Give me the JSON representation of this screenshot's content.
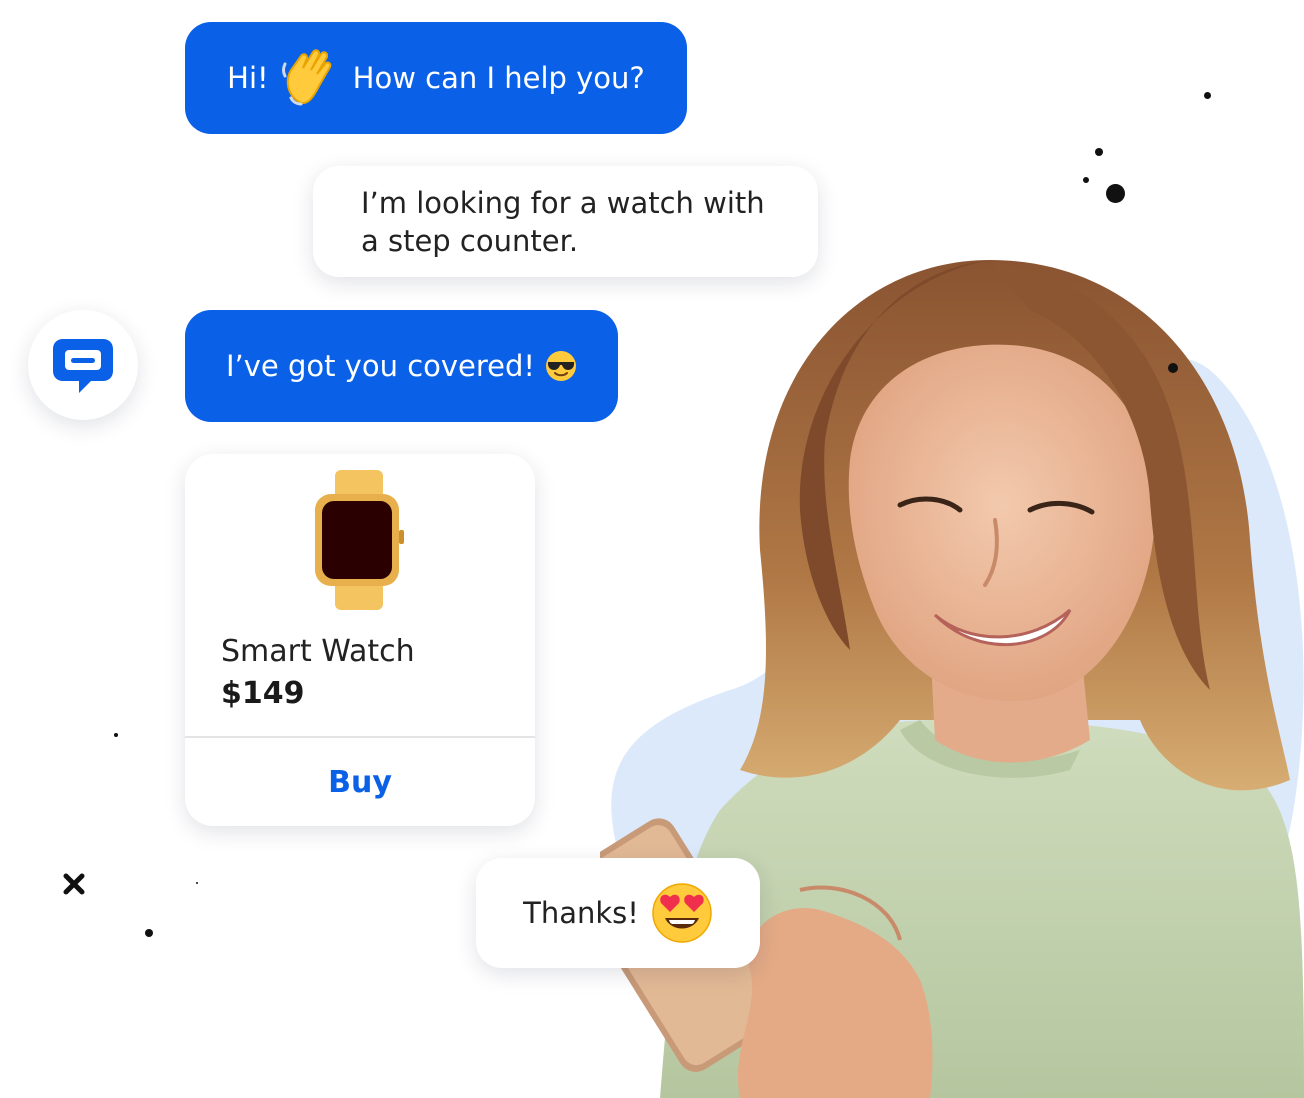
{
  "colors": {
    "brand_blue": "#0a60e6",
    "blob_blue": "#dbe9fb",
    "dot": "#111111"
  },
  "messages": {
    "greeting": {
      "before_emoji": "Hi!",
      "emoji": "waving-hand",
      "after_emoji": "How can I help you?"
    },
    "user_request": {
      "text": "I’m looking for a watch with\na step counter."
    },
    "agent_reply": {
      "text": "I’ve got you covered!",
      "emoji": "smiling-face-with-sunglasses"
    },
    "user_thanks": {
      "text": "Thanks!",
      "emoji": "smiling-face-with-heart-eyes"
    }
  },
  "product_card": {
    "image": "smart-watch",
    "name": "Smart Watch",
    "price": "$149",
    "buy_label": "Buy"
  },
  "logo": {
    "icon": "chat-bubble-logo"
  },
  "photo": {
    "subject": "smiling-woman-with-phone"
  }
}
